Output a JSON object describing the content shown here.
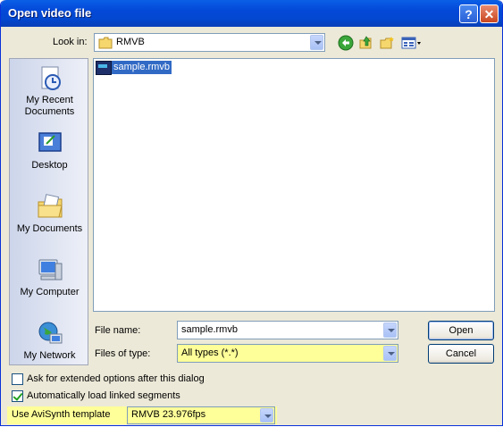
{
  "window": {
    "title": "Open video file"
  },
  "toolbar": {
    "look_in_label": "Look in:",
    "look_in_value": "RMVB",
    "icons": [
      "back-icon",
      "up-folder-icon",
      "new-folder-icon",
      "views-menu-icon"
    ]
  },
  "places": [
    {
      "label": "My Recent Documents",
      "icon": "recent-documents-icon"
    },
    {
      "label": "Desktop",
      "icon": "desktop-icon"
    },
    {
      "label": "My Documents",
      "icon": "my-documents-icon"
    },
    {
      "label": "My Computer",
      "icon": "my-computer-icon"
    },
    {
      "label": "My Network",
      "icon": "my-network-icon"
    }
  ],
  "files": [
    {
      "name": "sample.rmvb",
      "selected": true
    }
  ],
  "form": {
    "file_name_label": "File name:",
    "file_name_value": "sample.rmvb",
    "files_of_type_label": "Files of type:",
    "files_of_type_value": "All types (*.*)"
  },
  "buttons": {
    "open": "Open",
    "cancel": "Cancel"
  },
  "options": {
    "extended_label": "Ask for extended options after this dialog",
    "extended_checked": false,
    "linked_label": "Automatically load linked segments",
    "linked_checked": true
  },
  "avisynth": {
    "label": "Use AviSynth template",
    "value": "RMVB 23.976fps"
  },
  "colors": {
    "highlight": "#ffff99",
    "selection": "#316ac5",
    "titlebar": "#0348d8"
  }
}
